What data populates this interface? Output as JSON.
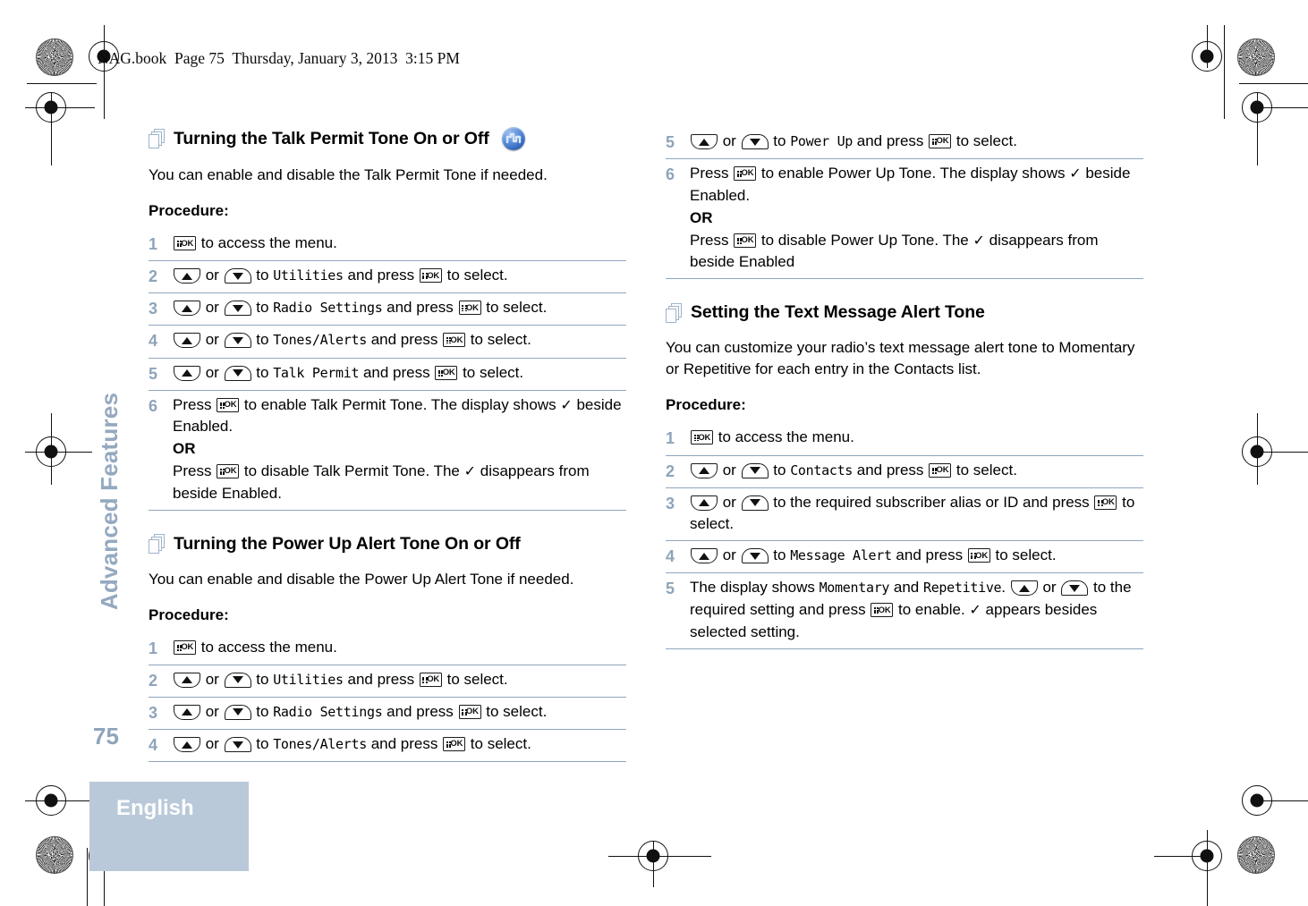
{
  "header": {
    "file_info": "NAG.book  Page 75  Thursday, January 3, 2013  3:15 PM"
  },
  "sidebar": {
    "chapter_title": "Advanced Features",
    "page_number": "75",
    "language": "English",
    "band_color": "#b9c9d9",
    "accent_color": "#8ea4bb"
  },
  "icons": {
    "pages_icon": "stacked-pages-icon",
    "tone_badge": "tone-signal-icon",
    "key_ok": "ok-menu-button-icon",
    "key_up": "up-arrow-button-icon",
    "key_down": "down-arrow-button-icon",
    "check": "✓"
  },
  "labels": {
    "procedure": "Procedure:",
    "or": "OR"
  },
  "sections": [
    {
      "id": "talk-permit-tone",
      "column": "left",
      "title": "Turning the Talk Permit Tone On or Off",
      "has_tone_badge": true,
      "intro": "You can enable and disable the Talk Permit Tone if needed.",
      "steps": [
        {
          "num": "1",
          "parts": [
            {
              "t": "key_ok"
            },
            {
              "t": "text",
              "v": " to access the menu."
            }
          ]
        },
        {
          "num": "2",
          "parts": [
            {
              "t": "key_up"
            },
            {
              "t": "text",
              "v": " or "
            },
            {
              "t": "key_down"
            },
            {
              "t": "text",
              "v": " to "
            },
            {
              "t": "disp",
              "v": "Utilities"
            },
            {
              "t": "text",
              "v": " and press "
            },
            {
              "t": "key_ok"
            },
            {
              "t": "text",
              "v": " to select."
            }
          ]
        },
        {
          "num": "3",
          "parts": [
            {
              "t": "key_up"
            },
            {
              "t": "text",
              "v": " or "
            },
            {
              "t": "key_down"
            },
            {
              "t": "text",
              "v": " to "
            },
            {
              "t": "disp",
              "v": "Radio Settings"
            },
            {
              "t": "text",
              "v": " and press "
            },
            {
              "t": "key_ok"
            },
            {
              "t": "text",
              "v": " to select."
            }
          ]
        },
        {
          "num": "4",
          "parts": [
            {
              "t": "key_up"
            },
            {
              "t": "text",
              "v": " or "
            },
            {
              "t": "key_down"
            },
            {
              "t": "text",
              "v": " to "
            },
            {
              "t": "disp",
              "v": "Tones/Alerts"
            },
            {
              "t": "text",
              "v": " and press "
            },
            {
              "t": "key_ok"
            },
            {
              "t": "text",
              "v": " to select."
            }
          ]
        },
        {
          "num": "5",
          "parts": [
            {
              "t": "key_up"
            },
            {
              "t": "text",
              "v": " or "
            },
            {
              "t": "key_down"
            },
            {
              "t": "text",
              "v": " to "
            },
            {
              "t": "disp",
              "v": "Talk Permit"
            },
            {
              "t": "text",
              "v": " and press "
            },
            {
              "t": "key_ok"
            },
            {
              "t": "text",
              "v": " to select."
            }
          ]
        },
        {
          "num": "6",
          "parts": [
            {
              "t": "text",
              "v": "Press "
            },
            {
              "t": "key_ok"
            },
            {
              "t": "text",
              "v": " to enable Talk Permit Tone. The display shows "
            },
            {
              "t": "check"
            },
            {
              "t": "text",
              "v": " beside Enabled."
            },
            {
              "t": "or"
            },
            {
              "t": "text",
              "v": "Press "
            },
            {
              "t": "key_ok"
            },
            {
              "t": "text",
              "v": " to disable Talk Permit Tone. The "
            },
            {
              "t": "check"
            },
            {
              "t": "text",
              "v": " disappears from beside Enabled."
            }
          ]
        }
      ]
    },
    {
      "id": "power-up-alert-tone",
      "column": "left",
      "title": "Turning the Power Up Alert Tone On or Off",
      "has_tone_badge": false,
      "intro": "You can enable and disable the Power Up Alert Tone if needed.",
      "steps": [
        {
          "num": "1",
          "parts": [
            {
              "t": "key_ok"
            },
            {
              "t": "text",
              "v": " to access the menu."
            }
          ]
        },
        {
          "num": "2",
          "parts": [
            {
              "t": "key_up"
            },
            {
              "t": "text",
              "v": " or "
            },
            {
              "t": "key_down"
            },
            {
              "t": "text",
              "v": " to "
            },
            {
              "t": "disp",
              "v": "Utilities"
            },
            {
              "t": "text",
              "v": " and press "
            },
            {
              "t": "key_ok"
            },
            {
              "t": "text",
              "v": " to select."
            }
          ]
        },
        {
          "num": "3",
          "parts": [
            {
              "t": "key_up"
            },
            {
              "t": "text",
              "v": " or "
            },
            {
              "t": "key_down"
            },
            {
              "t": "text",
              "v": " to "
            },
            {
              "t": "disp",
              "v": "Radio Settings"
            },
            {
              "t": "text",
              "v": " and press "
            },
            {
              "t": "key_ok"
            },
            {
              "t": "text",
              "v": " to select."
            }
          ]
        },
        {
          "num": "4",
          "parts": [
            {
              "t": "key_up"
            },
            {
              "t": "text",
              "v": " or "
            },
            {
              "t": "key_down"
            },
            {
              "t": "text",
              "v": " to "
            },
            {
              "t": "disp",
              "v": "Tones/Alerts"
            },
            {
              "t": "text",
              "v": " and press "
            },
            {
              "t": "key_ok"
            },
            {
              "t": "text",
              "v": " to select."
            }
          ]
        }
      ]
    },
    {
      "id": "power-up-continued",
      "column": "right",
      "title": null,
      "has_tone_badge": false,
      "intro": null,
      "steps": [
        {
          "num": "5",
          "parts": [
            {
              "t": "key_up"
            },
            {
              "t": "text",
              "v": " or "
            },
            {
              "t": "key_down"
            },
            {
              "t": "text",
              "v": " to "
            },
            {
              "t": "disp",
              "v": "Power Up"
            },
            {
              "t": "text",
              "v": " and press "
            },
            {
              "t": "key_ok"
            },
            {
              "t": "text",
              "v": " to select."
            }
          ]
        },
        {
          "num": "6",
          "parts": [
            {
              "t": "text",
              "v": "Press "
            },
            {
              "t": "key_ok"
            },
            {
              "t": "text",
              "v": " to enable Power Up Tone. The display shows "
            },
            {
              "t": "check"
            },
            {
              "t": "text",
              "v": " beside Enabled."
            },
            {
              "t": "or"
            },
            {
              "t": "text",
              "v": "Press "
            },
            {
              "t": "key_ok"
            },
            {
              "t": "text",
              "v": " to disable Power Up Tone. The "
            },
            {
              "t": "check"
            },
            {
              "t": "text",
              "v": " disappears from beside Enabled"
            }
          ]
        }
      ]
    },
    {
      "id": "text-message-alert-tone",
      "column": "right",
      "title": "Setting the Text Message Alert Tone",
      "has_tone_badge": false,
      "intro": "You can customize your radio’s text message alert tone to Momentary or Repetitive for each entry in the Contacts list.",
      "steps": [
        {
          "num": "1",
          "parts": [
            {
              "t": "key_ok"
            },
            {
              "t": "text",
              "v": " to access the menu."
            }
          ]
        },
        {
          "num": "2",
          "parts": [
            {
              "t": "key_up"
            },
            {
              "t": "text",
              "v": " or "
            },
            {
              "t": "key_down"
            },
            {
              "t": "text",
              "v": " to "
            },
            {
              "t": "disp",
              "v": "Contacts"
            },
            {
              "t": "text",
              "v": " and press "
            },
            {
              "t": "key_ok"
            },
            {
              "t": "text",
              "v": " to select."
            }
          ]
        },
        {
          "num": "3",
          "parts": [
            {
              "t": "key_up"
            },
            {
              "t": "text",
              "v": " or "
            },
            {
              "t": "key_down"
            },
            {
              "t": "text",
              "v": " to the required subscriber alias or ID and press "
            },
            {
              "t": "key_ok"
            },
            {
              "t": "text",
              "v": " to select."
            }
          ]
        },
        {
          "num": "4",
          "parts": [
            {
              "t": "key_up"
            },
            {
              "t": "text",
              "v": " or "
            },
            {
              "t": "key_down"
            },
            {
              "t": "text",
              "v": " to "
            },
            {
              "t": "disp",
              "v": "Message Alert"
            },
            {
              "t": "text",
              "v": " and press "
            },
            {
              "t": "key_ok"
            },
            {
              "t": "text",
              "v": " to select."
            }
          ]
        },
        {
          "num": "5",
          "parts": [
            {
              "t": "text",
              "v": "The display shows "
            },
            {
              "t": "disp",
              "v": "Momentary"
            },
            {
              "t": "text",
              "v": " and "
            },
            {
              "t": "disp",
              "v": "Repetitive"
            },
            {
              "t": "text",
              "v": ". "
            },
            {
              "t": "key_up"
            },
            {
              "t": "text",
              "v": " or "
            },
            {
              "t": "key_down"
            },
            {
              "t": "text",
              "v": " to the required setting and press "
            },
            {
              "t": "key_ok"
            },
            {
              "t": "text",
              "v": " to enable. "
            },
            {
              "t": "check"
            },
            {
              "t": "text",
              "v": " appears besides selected setting."
            }
          ]
        }
      ]
    }
  ]
}
